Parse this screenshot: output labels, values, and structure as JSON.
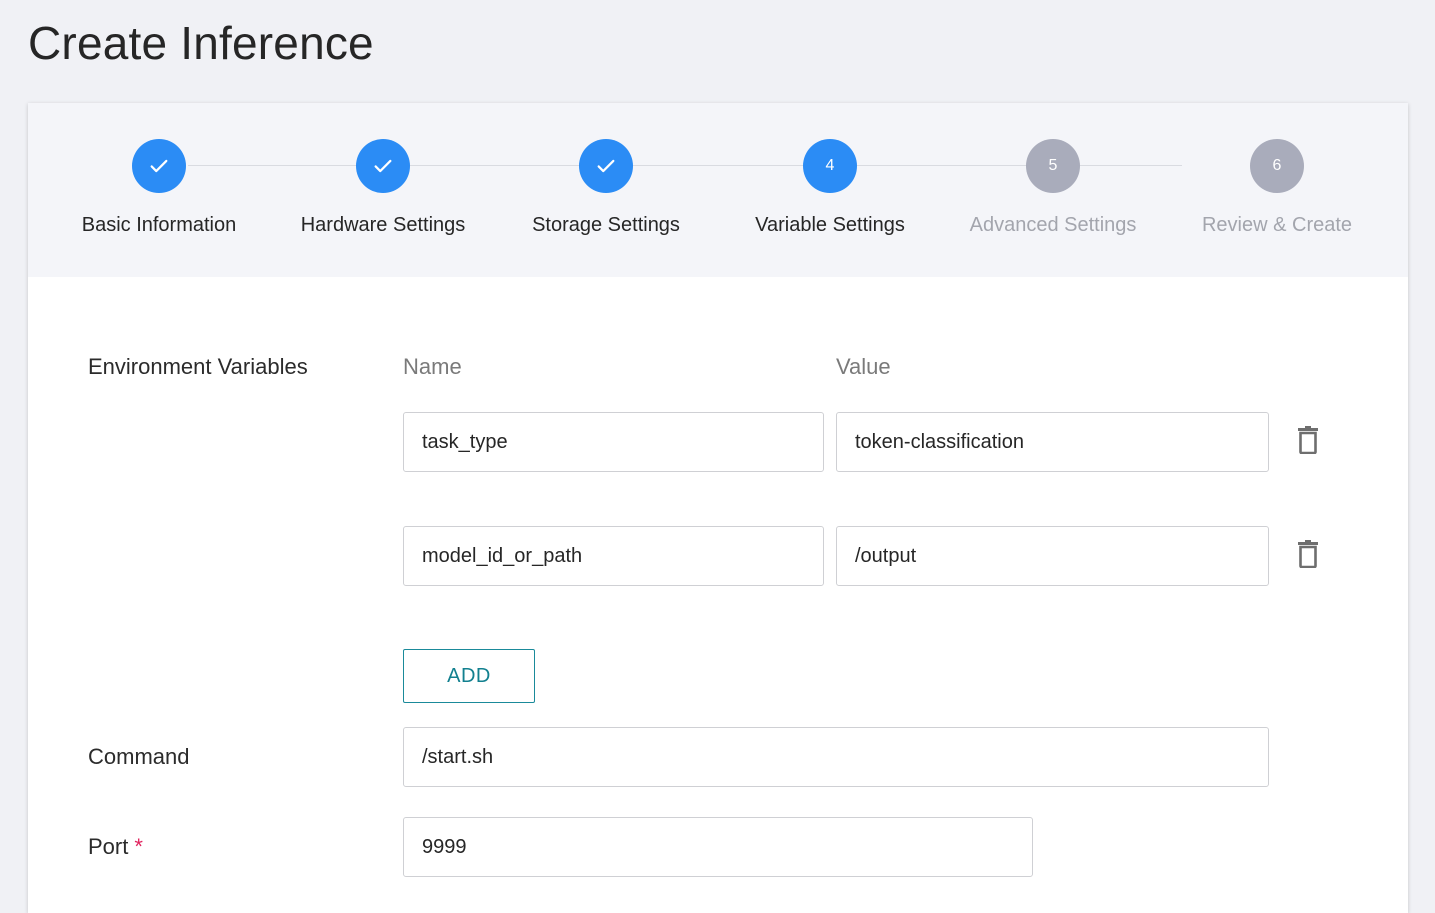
{
  "page": {
    "title": "Create Inference"
  },
  "stepper": {
    "steps": [
      {
        "number": "1",
        "label": "Basic Information",
        "state": "done"
      },
      {
        "number": "2",
        "label": "Hardware Settings",
        "state": "done"
      },
      {
        "number": "3",
        "label": "Storage Settings",
        "state": "done"
      },
      {
        "number": "4",
        "label": "Variable Settings",
        "state": "active"
      },
      {
        "number": "5",
        "label": "Advanced Settings",
        "state": "pending"
      },
      {
        "number": "6",
        "label": "Review & Create",
        "state": "pending"
      }
    ],
    "colors": {
      "done": "#2b8cf5",
      "pending": "#a9acbb"
    }
  },
  "env": {
    "label": "Environment Variables",
    "name_header": "Name",
    "value_header": "Value",
    "rows": [
      {
        "name": "task_type",
        "value": "token-classification"
      },
      {
        "name": "model_id_or_path",
        "value": "/output"
      }
    ],
    "add_label": "ADD"
  },
  "command": {
    "label": "Command",
    "value": "/start.sh"
  },
  "port": {
    "label": "Port",
    "required_mark": "*",
    "value": "9999"
  }
}
